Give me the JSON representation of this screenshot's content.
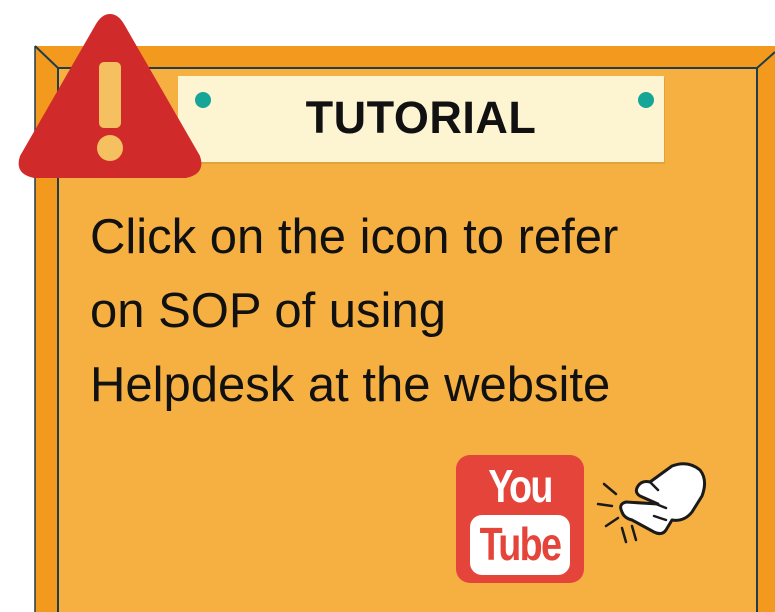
{
  "title": "TUTORIAL",
  "message_lines": [
    "Click on the icon to refer",
    "on SOP of using",
    "Helpdesk at the website"
  ],
  "youtube": {
    "top_word": "You",
    "bottom_word": "Tube"
  },
  "icons": {
    "warning": "warning-exclamation-icon",
    "youtube": "youtube-icon",
    "pointer": "pointing-hand-icon"
  },
  "colors": {
    "board_fill": "#f5b041",
    "board_frame": "#f39a1e",
    "board_line": "#1f3d4a",
    "title_card": "#fdf4d2",
    "pin": "#16a596",
    "warning": "#d12a2a",
    "youtube": "#e5443a"
  }
}
